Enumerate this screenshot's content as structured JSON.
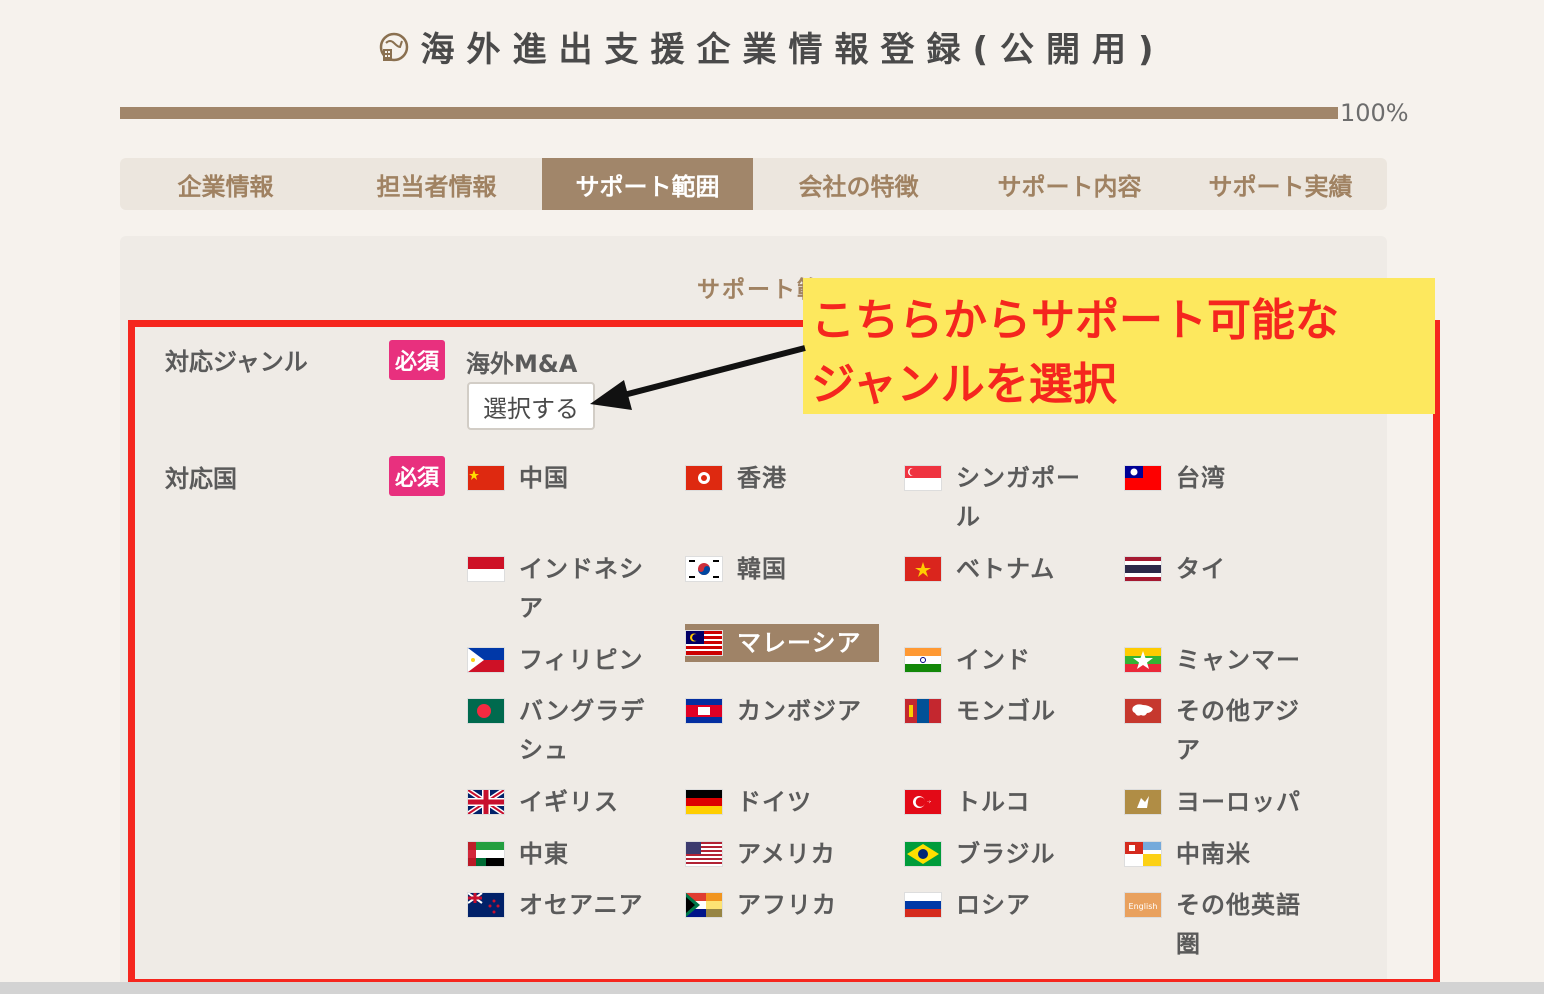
{
  "header": {
    "title": "海外進出支援企業情報登録(公開用)",
    "icon": "globe-building-icon"
  },
  "progress": {
    "percent": 100,
    "label": "100%"
  },
  "tabs": [
    {
      "label": "企業情報",
      "active": false
    },
    {
      "label": "担当者情報",
      "active": false
    },
    {
      "label": "サポート範囲",
      "active": true
    },
    {
      "label": "会社の特徴",
      "active": false
    },
    {
      "label": "サポート内容",
      "active": false
    },
    {
      "label": "サポート実績",
      "active": false
    }
  ],
  "section": {
    "heading": "サポート範囲"
  },
  "genre": {
    "label": "対応ジャンル",
    "required": "必須",
    "value": "海外M&A",
    "select_button": "選択する"
  },
  "countries": {
    "label": "対応国",
    "required": "必須",
    "items": [
      {
        "name": "中国",
        "flag": "china-flag",
        "selected": false
      },
      {
        "name": "香港",
        "flag": "hongkong-flag",
        "selected": false
      },
      {
        "name": "シンガポール",
        "flag": "singapore-flag",
        "selected": false
      },
      {
        "name": "台湾",
        "flag": "taiwan-flag",
        "selected": false
      },
      {
        "name": "インドネシア",
        "flag": "indonesia-flag",
        "selected": false
      },
      {
        "name": "韓国",
        "flag": "korea-flag",
        "selected": false
      },
      {
        "name": "ベトナム",
        "flag": "vietnam-flag",
        "selected": false
      },
      {
        "name": "タイ",
        "flag": "thailand-flag",
        "selected": false
      },
      {
        "name": "フィリピン",
        "flag": "philippines-flag",
        "selected": false
      },
      {
        "name": "マレーシア",
        "flag": "malaysia-flag",
        "selected": true
      },
      {
        "name": "インド",
        "flag": "india-flag",
        "selected": false
      },
      {
        "name": "ミャンマー",
        "flag": "myanmar-flag",
        "selected": false
      },
      {
        "name": "バングラデシュ",
        "flag": "bangladesh-flag",
        "selected": false
      },
      {
        "name": "カンボジア",
        "flag": "cambodia-flag",
        "selected": false
      },
      {
        "name": "モンゴル",
        "flag": "mongolia-flag",
        "selected": false
      },
      {
        "name": "その他アジア",
        "flag": "asia-map-flag",
        "selected": false
      },
      {
        "name": "イギリス",
        "flag": "uk-flag",
        "selected": false
      },
      {
        "name": "ドイツ",
        "flag": "germany-flag",
        "selected": false
      },
      {
        "name": "トルコ",
        "flag": "turkey-flag",
        "selected": false
      },
      {
        "name": "ヨーロッパ",
        "flag": "europe-map-flag",
        "selected": false
      },
      {
        "name": "中東",
        "flag": "middle-east-flag",
        "selected": false
      },
      {
        "name": "アメリカ",
        "flag": "usa-flag",
        "selected": false
      },
      {
        "name": "ブラジル",
        "flag": "brazil-flag",
        "selected": false
      },
      {
        "name": "中南米",
        "flag": "latin-america-flag",
        "selected": false
      },
      {
        "name": "オセアニア",
        "flag": "oceania-flag",
        "selected": false
      },
      {
        "name": "アフリカ",
        "flag": "africa-flag",
        "selected": false
      },
      {
        "name": "ロシア",
        "flag": "russia-flag",
        "selected": false
      },
      {
        "name": "その他英語圏",
        "flag": "english-flag",
        "selected": false
      }
    ],
    "english_badge": "English"
  },
  "callout": {
    "line1": "こちらからサポート可能な",
    "line2": "ジャンルを選択"
  },
  "colors": {
    "accent": "#a1866a",
    "required": "#e8307e",
    "annotation_red": "#f5261e",
    "annotation_yellow": "#fde85e"
  }
}
